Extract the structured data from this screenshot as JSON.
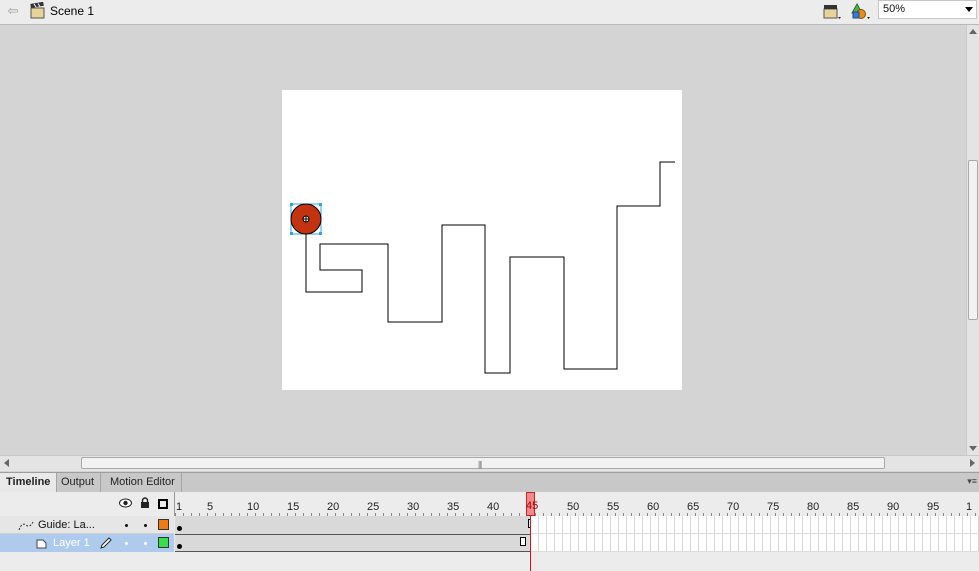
{
  "edit_bar": {
    "scene_name": "Scene 1",
    "zoom": "50%"
  },
  "panel_tabs": [
    "Timeline",
    "Output",
    "Motion Editor"
  ],
  "timeline": {
    "ruler_ticks": [
      "1",
      "5",
      "10",
      "15",
      "20",
      "25",
      "30",
      "35",
      "40",
      "45",
      "50",
      "55",
      "60",
      "65",
      "70",
      "75",
      "80",
      "85",
      "90",
      "95",
      "1"
    ],
    "current_frame": "45",
    "layers": [
      {
        "name": "Guide: La...",
        "color": "#f07a14",
        "selected": false
      },
      {
        "name": "Layer 1",
        "color": "#35e04a",
        "selected": true
      }
    ]
  },
  "stage": {
    "ball_color": "#c33310",
    "background": "#ffffff"
  }
}
